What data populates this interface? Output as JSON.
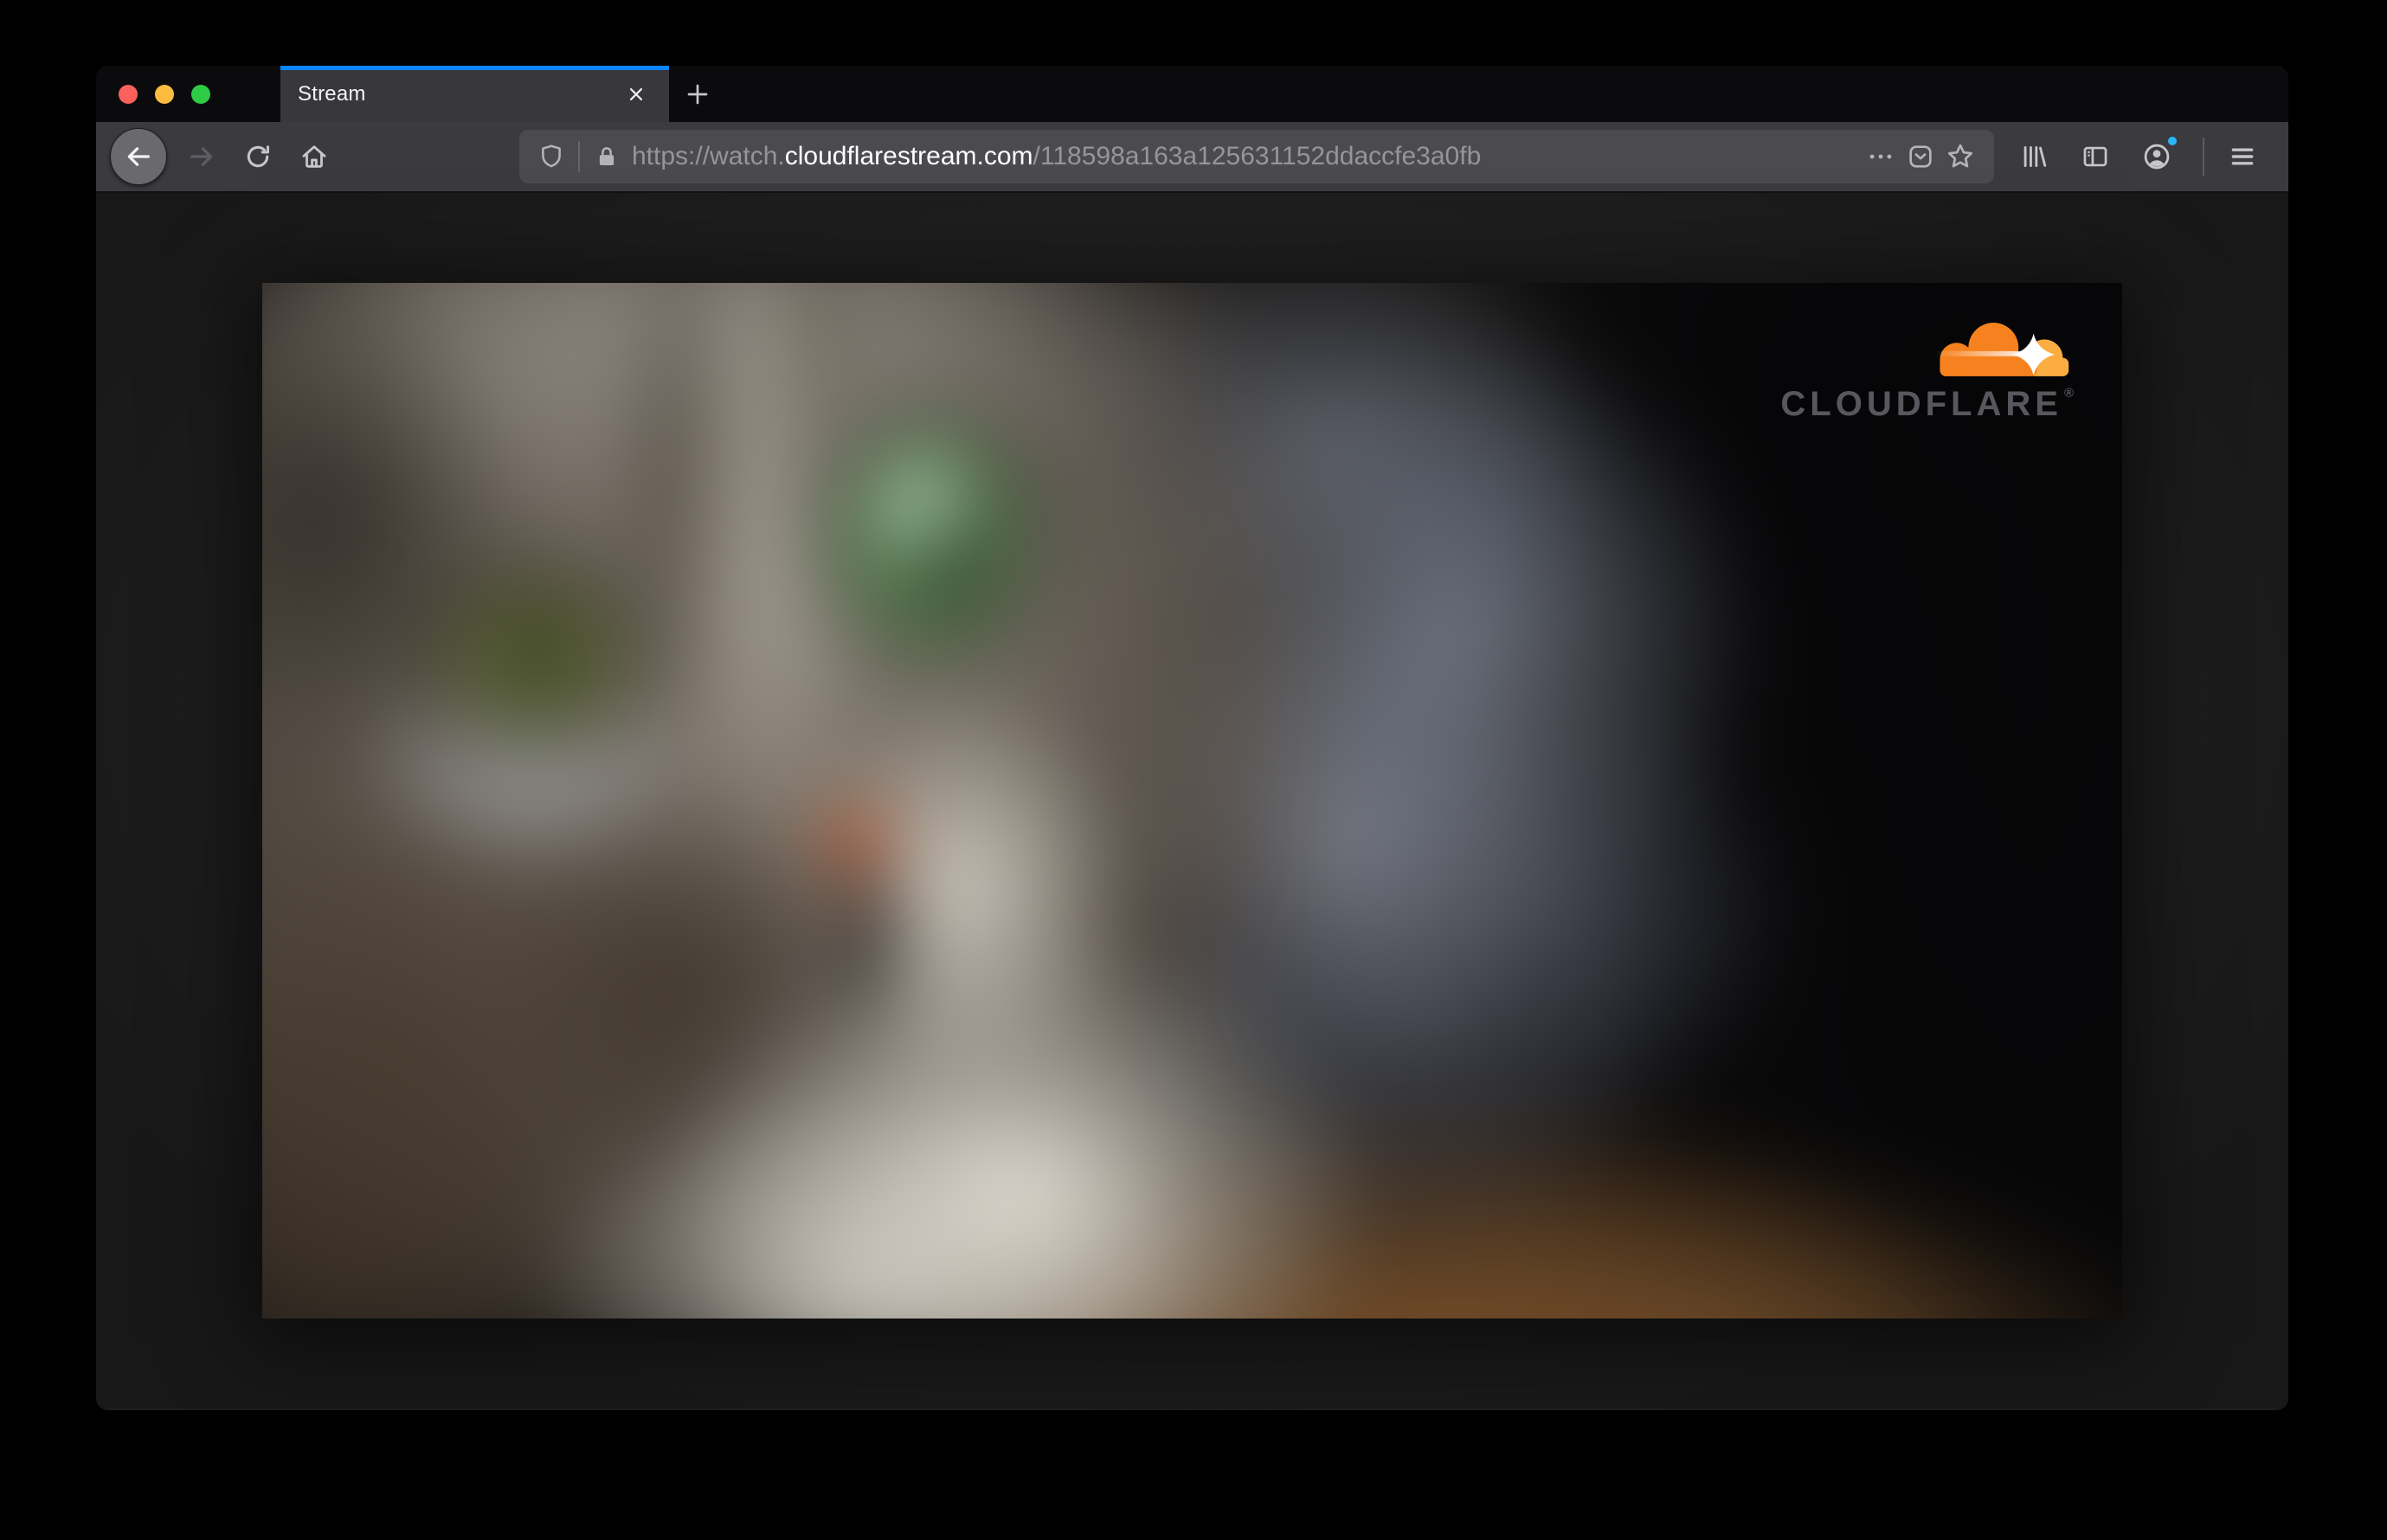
{
  "browser": {
    "window_controls": {
      "close_color": "#fb615c",
      "minimize_color": "#fdbc40",
      "zoom_color": "#2ecc46"
    },
    "tab_bar": {
      "active_tab": {
        "title": "Stream",
        "accent_color": "#0a84ff",
        "close_icon": "x-icon"
      },
      "new_tab_icon": "plus-icon"
    },
    "navigation_icons": {
      "back": "arrow-left-icon",
      "forward": "arrow-right-icon",
      "reload": "reload-icon",
      "home": "home-icon"
    },
    "address_bar": {
      "tracking_shield_icon": "shield-icon",
      "lock_icon": "padlock-icon",
      "url_scheme_subdomain": "https://watch.",
      "url_domain": "cloudflarestream.com",
      "url_path": "/118598a163a125631152ddaccfe3a0fb",
      "page_actions_icon": "ellipsis-icon",
      "pocket_icon": "pocket-save-icon",
      "bookmark_icon": "star-icon"
    },
    "toolbar_right": {
      "library_icon": "library-icon",
      "sidebar_icon": "sidebar-icon",
      "account_icon": "account-icon",
      "account_notification_color": "#29b6f6",
      "menu_icon": "hamburger-menu-icon"
    }
  },
  "page": {
    "background_color": "#1d1d1d",
    "video": {
      "content_description": "Blurred close-up video frame of a grey tabby cat with green eyes",
      "watermark": {
        "text": "CLOUDFLARE",
        "trademark_mark": "®",
        "cloud_primary": "#f6821f",
        "cloud_secondary": "#fbad41",
        "text_color": "#57585e"
      }
    }
  }
}
